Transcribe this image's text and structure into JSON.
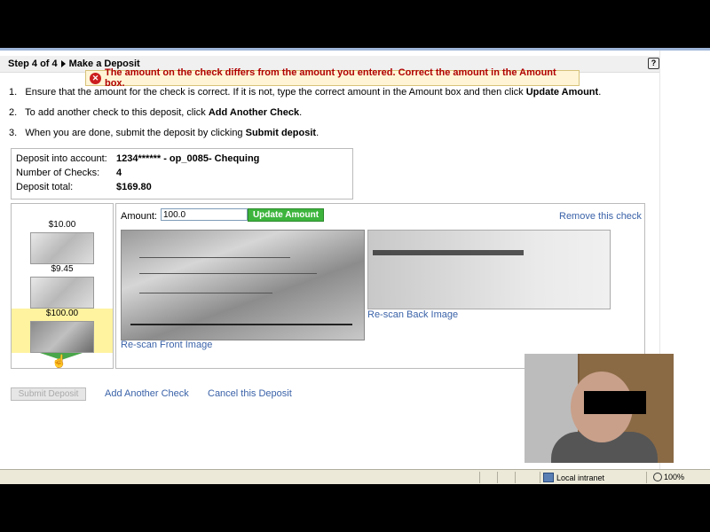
{
  "step": {
    "title": "Step 4 of 4",
    "page": "Make a Deposit",
    "help_label": "?"
  },
  "error_message": "The amount on the check differs from the amount you entered. Correct the amount in the Amount box.",
  "instructions": [
    {
      "num": "1.",
      "text": "Ensure that the amount for the check is correct. If it is not, type the correct amount in the Amount box and then click ",
      "bold": "Update Amount",
      "tail": "."
    },
    {
      "num": "2.",
      "text": "To add another check to this deposit, click ",
      "bold": "Add Another Check",
      "tail": "."
    },
    {
      "num": "3.",
      "text": "When you are done, submit the deposit by clicking ",
      "bold": "Submit deposit",
      "tail": "."
    }
  ],
  "summary": {
    "account_label": "Deposit into account:",
    "account_value": "1234****** - op_0085- Chequing",
    "checks_label": "Number of Checks:",
    "checks_value": "4",
    "total_label": "Deposit total:",
    "total_value": "$169.80"
  },
  "thumbnails": [
    {
      "amount": "$10.00",
      "selected": false
    },
    {
      "amount": "$9.45",
      "selected": false
    },
    {
      "amount": "$100.00",
      "selected": true
    }
  ],
  "detail": {
    "amount_label": "Amount:",
    "amount_value": "100.0",
    "update_label": "Update Amount",
    "remove_label": "Remove this check",
    "rescan_front": "Re-scan Front Image",
    "rescan_back": "Re-scan Back Image"
  },
  "actions": {
    "submit": "Submit Deposit",
    "add": "Add Another Check",
    "cancel": "Cancel this Deposit"
  },
  "status": {
    "zone": "Local intranet",
    "zoom": "100%"
  }
}
